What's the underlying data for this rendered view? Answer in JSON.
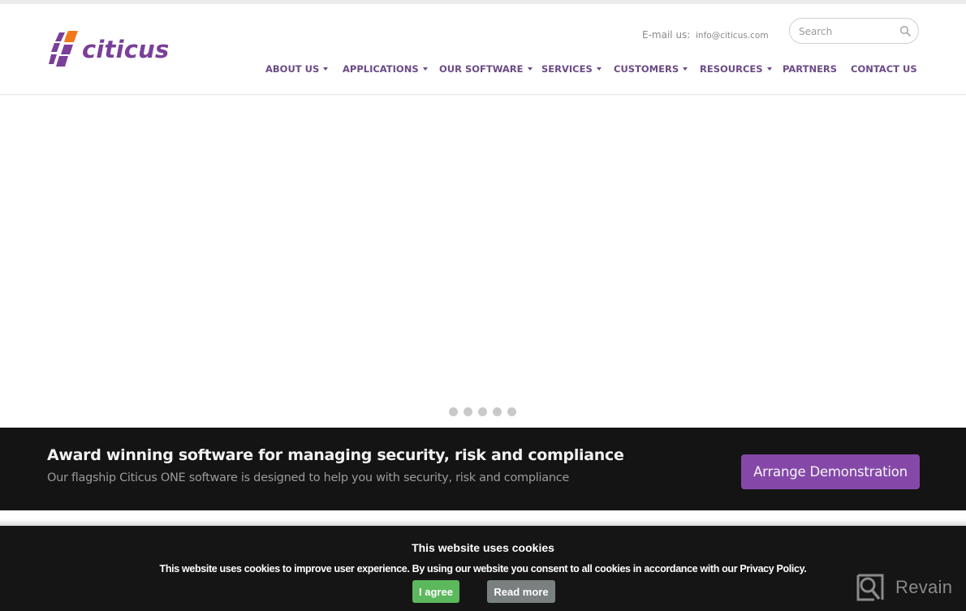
{
  "brand": {
    "name": "citicus",
    "primary_color": "#7a3f98",
    "accent_color": "#f07a1a"
  },
  "header": {
    "email_label": "E-mail us:",
    "email_value": "info@citicus.com",
    "search": {
      "placeholder": "Search",
      "value": "",
      "icon": "search-icon"
    }
  },
  "nav": {
    "items": [
      {
        "label": "ABOUT US",
        "has_dropdown": true
      },
      {
        "label": "APPLICATIONS",
        "has_dropdown": true
      },
      {
        "label": "OUR SOFTWARE",
        "has_dropdown": true
      },
      {
        "label": "SERVICES",
        "has_dropdown": true
      },
      {
        "label": "CUSTOMERS",
        "has_dropdown": true
      },
      {
        "label": "RESOURCES",
        "has_dropdown": true
      },
      {
        "label": "PARTNERS",
        "has_dropdown": false
      },
      {
        "label": "CONTACT US",
        "has_dropdown": false
      }
    ]
  },
  "carousel": {
    "slide_count": 5
  },
  "banner": {
    "title": "Award winning software for managing security, risk and compliance",
    "subtitle": "Our flagship Citicus ONE software is designed to help you with security, risk and compliance",
    "cta_label": "Arrange Demonstration",
    "cta_color": "#8548a8"
  },
  "cookie_notice": {
    "title": "This website uses cookies",
    "text": "This website uses cookies to improve user experience. By using our website you consent to all cookies in accordance with our Privacy Policy.",
    "agree_label": "I agree",
    "read_more_label": "Read more",
    "agree_color": "#5cb85c",
    "read_more_color": "#7a8080"
  },
  "watermark": {
    "label": "Revain",
    "icon": "revain-logo-icon"
  }
}
